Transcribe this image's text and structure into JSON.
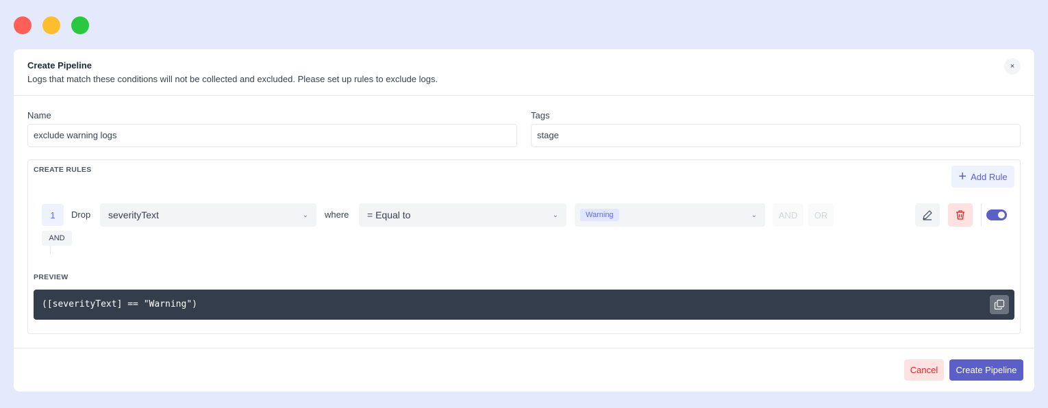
{
  "modal": {
    "title": "Create Pipeline",
    "subtitle": "Logs that match these conditions will not be collected and excluded. Please set up rules to exclude logs.",
    "close_label": "×"
  },
  "form": {
    "name_label": "Name",
    "name_value": "exclude warning logs",
    "tags_label": "Tags",
    "tags_value": "stage"
  },
  "rules": {
    "section_label": "CREATE RULES",
    "add_rule_label": "Add Rule",
    "items": [
      {
        "number": "1",
        "action": "Drop",
        "field": "severityText",
        "where_label": "where",
        "operator": "= Equal to",
        "value_tag": "Warning",
        "and_label": "AND",
        "or_label": "OR",
        "enabled": true
      }
    ],
    "connector_label": "AND"
  },
  "preview": {
    "section_label": "PREVIEW",
    "expression": "([severityText] == \"Warning\")"
  },
  "footer": {
    "cancel_label": "Cancel",
    "create_label": "Create Pipeline"
  },
  "colors": {
    "accent": "#5b5fc7",
    "danger": "#dc2626",
    "preview_bg": "#343d4c",
    "page_bg": "#e4eafc"
  }
}
